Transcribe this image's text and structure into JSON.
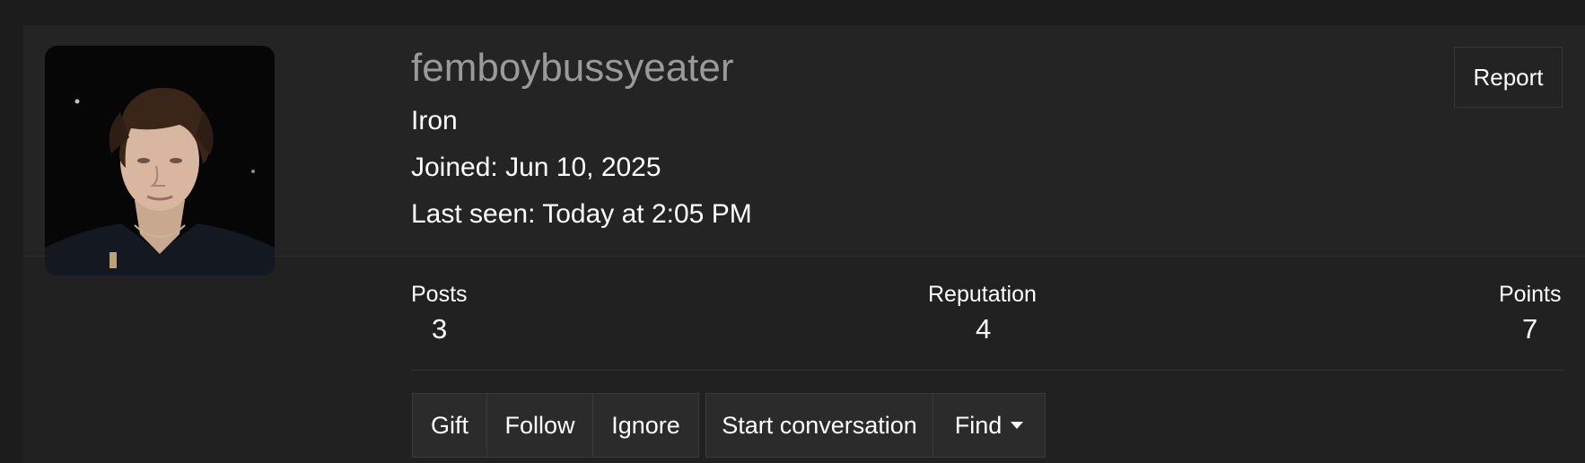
{
  "profile": {
    "username": "femboybussyeater",
    "rank": "Iron",
    "joined": "Joined: Jun 10, 2025",
    "last_seen": "Last seen: Today at 2:05 PM",
    "avatar_alt": "profile photo"
  },
  "actions": {
    "report_label": "Report"
  },
  "stats": {
    "posts_label": "Posts",
    "posts_value": "3",
    "reputation_label": "Reputation",
    "reputation_value": "4",
    "points_label": "Points",
    "points_value": "7"
  },
  "buttons": {
    "gift": "Gift",
    "follow": "Follow",
    "ignore": "Ignore",
    "start_conversation": "Start conversation",
    "find": "Find"
  },
  "icons": {
    "find_caret": "caret-down-icon"
  },
  "colors": {
    "page_bg": "#1c1c1c",
    "header_bg": "#242424",
    "username": "#9a9a9a",
    "text": "#ffffff",
    "button_bg": "#2b2b2b",
    "border": "#3a3a3a"
  }
}
